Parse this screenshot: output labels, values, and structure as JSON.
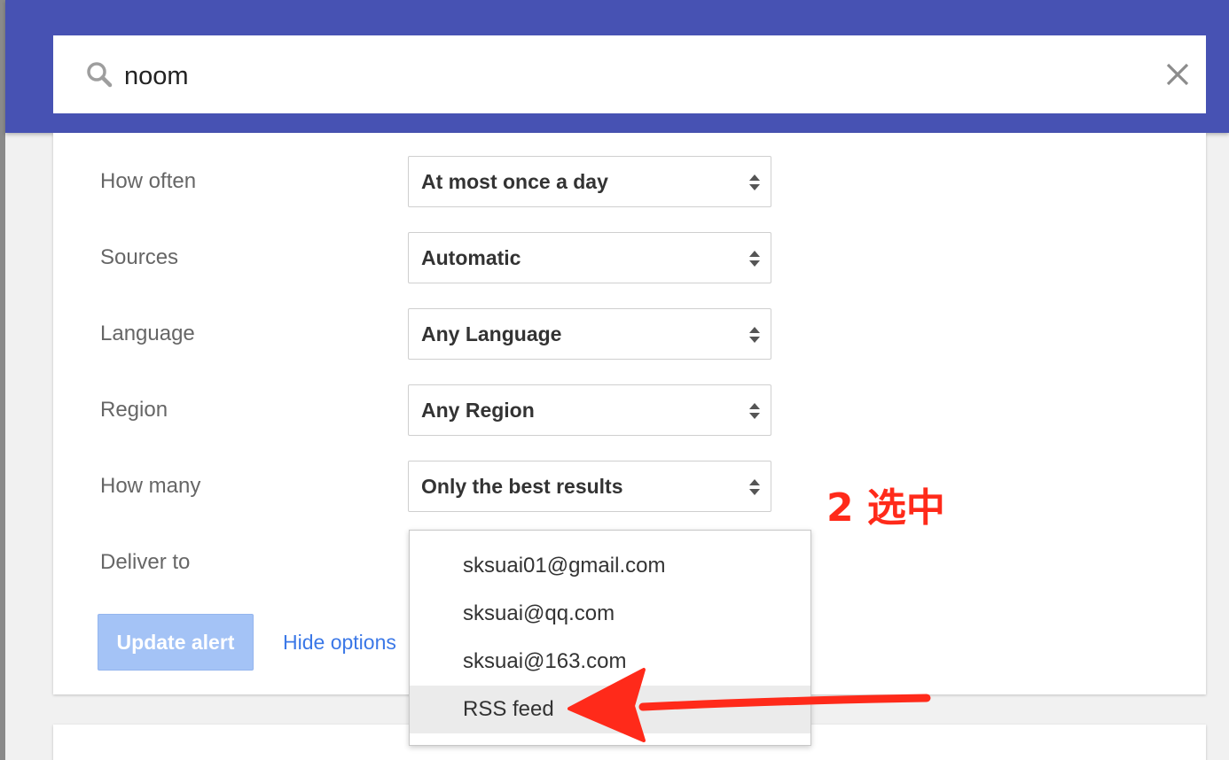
{
  "search": {
    "query": "noom"
  },
  "options": [
    {
      "label": "How often",
      "value": "At most once a day"
    },
    {
      "label": "Sources",
      "value": "Automatic"
    },
    {
      "label": "Language",
      "value": "Any Language"
    },
    {
      "label": "Region",
      "value": "Any Region"
    },
    {
      "label": "How many",
      "value": "Only the best results"
    }
  ],
  "deliver": {
    "label": "Deliver to",
    "items": [
      {
        "label": "sksuai01@gmail.com"
      },
      {
        "label": "sksuai@qq.com"
      },
      {
        "label": "sksuai@163.com"
      },
      {
        "label": "RSS feed"
      }
    ]
  },
  "actions": {
    "update_label": "Update alert",
    "hide_label": "Hide options"
  },
  "annotation": {
    "text": "2 选中"
  },
  "colors": {
    "header": "#4752b3",
    "annotation": "#ff2a1a",
    "link": "#3b78e7",
    "button_disabled": "#a4c3f6"
  }
}
